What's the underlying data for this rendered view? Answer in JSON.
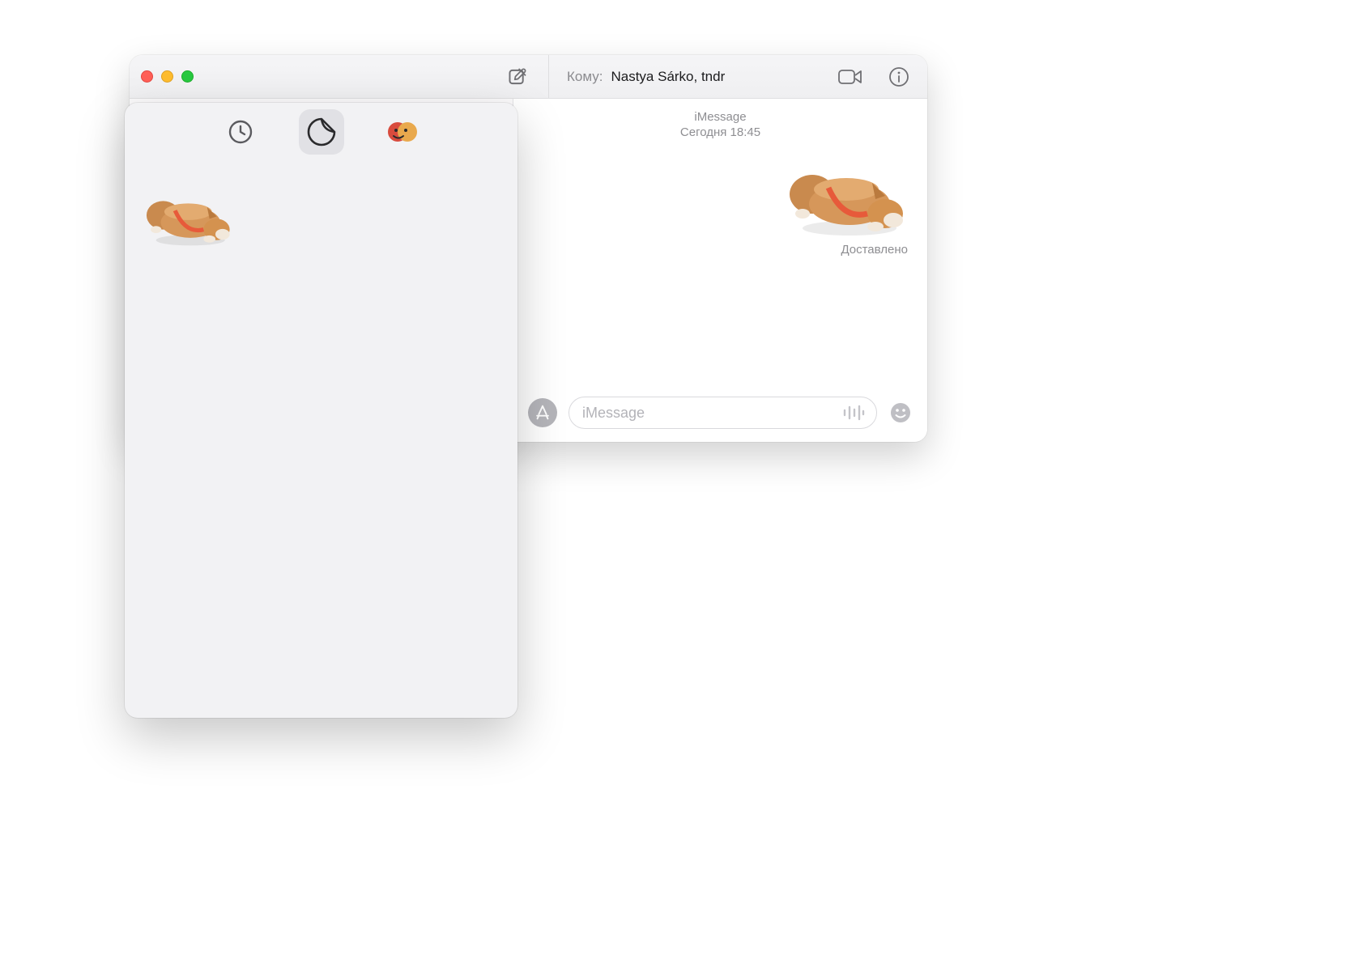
{
  "window": {
    "traffic": {
      "close": "close",
      "minimize": "minimize",
      "zoom": "zoom"
    },
    "compose_icon": "compose-icon"
  },
  "header": {
    "to_label": "Кому:",
    "recipients": "Nastya Sárko, tndr",
    "video_icon": "video-call-icon",
    "info_icon": "info-icon"
  },
  "thread": {
    "service_label": "iMessage",
    "timestamp": "Сегодня 18:45",
    "sent_sticker": "corgi-lying-sticker",
    "delivery_status": "Доставлено"
  },
  "composer": {
    "apps_icon": "app-store-icon",
    "placeholder": "iMessage",
    "audio_icon": "audio-waveform-icon",
    "emoji_icon": "emoji-picker-icon"
  },
  "drawer": {
    "tabs": [
      {
        "id": "recents",
        "icon": "clock-icon",
        "active": false
      },
      {
        "id": "stickers",
        "icon": "sticker-peel-icon",
        "active": true
      },
      {
        "id": "memoji",
        "icon": "memoji-pack-icon",
        "active": false
      }
    ],
    "stickers": [
      {
        "id": "corgi-lying-sticker",
        "label": "corgi lying down"
      }
    ]
  },
  "colors": {
    "chrome": "#f2f2f4",
    "text_secondary": "#8e8e92",
    "traffic_red": "#ff5f57",
    "traffic_yellow": "#febc2e",
    "traffic_green": "#28c840"
  }
}
